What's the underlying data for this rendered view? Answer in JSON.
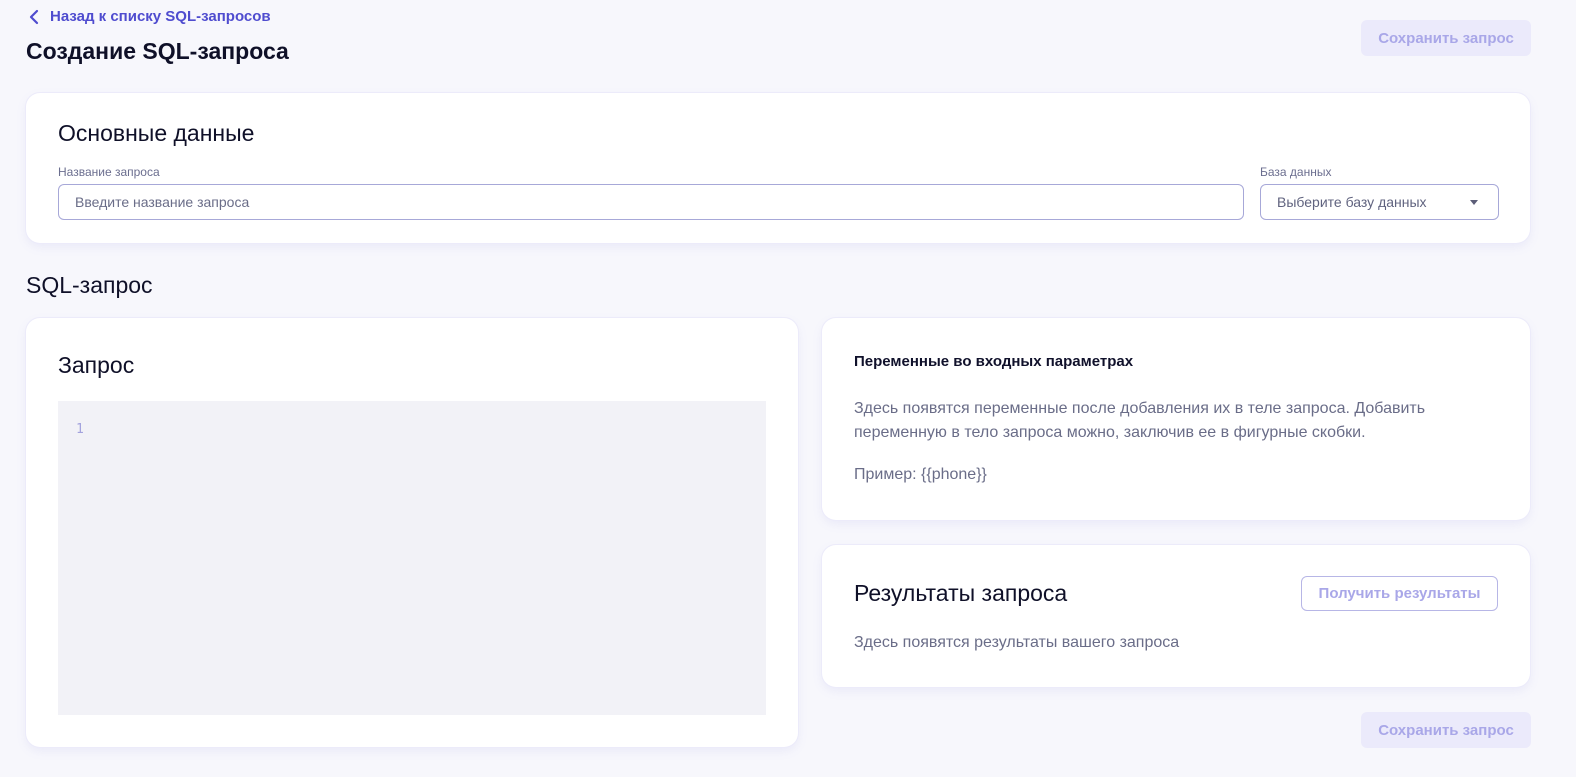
{
  "header": {
    "back_link": "Назад к списку SQL-запросов",
    "title": "Создание SQL-запроса",
    "save_label": "Сохранить запрос"
  },
  "main_data": {
    "title": "Основные данные",
    "name_label": "Название запроса",
    "name_placeholder": "Введите название запроса",
    "name_value": "",
    "db_label": "База данных",
    "db_selected": "Выберите базу данных"
  },
  "sql_section": {
    "title": "SQL-запрос",
    "query_card_title": "Запрос",
    "editor_line_number": "1"
  },
  "variables": {
    "title": "Переменные во входных параметрах",
    "description": "Здесь появятся переменные после добавления их в теле запроса. Добавить переменную в тело запроса можно, заключив ее в фигурные скобки.",
    "example": "Пример: {{phone}}"
  },
  "results": {
    "title": "Результаты запроса",
    "button_label": "Получить результаты",
    "description": "Здесь появятся результаты вашего запроса"
  },
  "footer": {
    "save_label": "Сохранить запрос"
  },
  "colors": {
    "accent": "#4f4ccf",
    "disabled_button_bg": "#ebeafb",
    "disabled_button_text": "#a9a7e8",
    "page_bg": "#f7f7fc"
  },
  "icons": {
    "back": "chevron-left-icon",
    "select": "caret-down-icon"
  }
}
